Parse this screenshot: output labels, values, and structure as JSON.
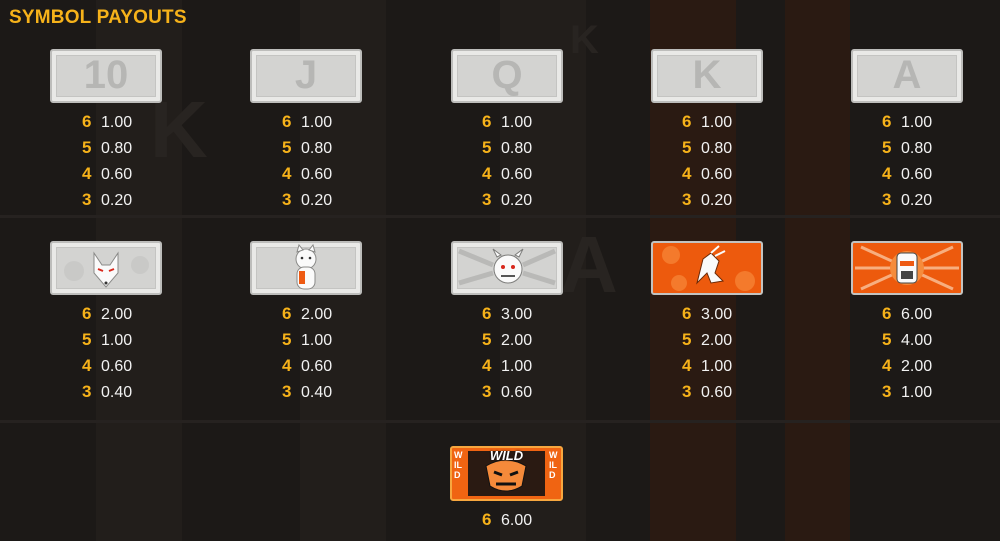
{
  "title": "SYMBOL PAYOUTS",
  "colors": {
    "accent": "#f6b21a",
    "value": "#f2f2f2",
    "background": "#1c1917",
    "orange": "#ed5a0d"
  },
  "symbols": [
    {
      "id": "ten",
      "label": "10",
      "icon": "ten-card-icon",
      "payouts": [
        {
          "count": "6",
          "value": "1.00"
        },
        {
          "count": "5",
          "value": "0.80"
        },
        {
          "count": "4",
          "value": "0.60"
        },
        {
          "count": "3",
          "value": "0.20"
        }
      ]
    },
    {
      "id": "jack",
      "label": "J",
      "icon": "jack-card-icon",
      "payouts": [
        {
          "count": "6",
          "value": "1.00"
        },
        {
          "count": "5",
          "value": "0.80"
        },
        {
          "count": "4",
          "value": "0.60"
        },
        {
          "count": "3",
          "value": "0.20"
        }
      ]
    },
    {
      "id": "queen",
      "label": "Q",
      "icon": "queen-card-icon",
      "payouts": [
        {
          "count": "6",
          "value": "1.00"
        },
        {
          "count": "5",
          "value": "0.80"
        },
        {
          "count": "4",
          "value": "0.60"
        },
        {
          "count": "3",
          "value": "0.20"
        }
      ]
    },
    {
      "id": "king",
      "label": "K",
      "icon": "king-card-icon",
      "payouts": [
        {
          "count": "6",
          "value": "1.00"
        },
        {
          "count": "5",
          "value": "0.80"
        },
        {
          "count": "4",
          "value": "0.60"
        },
        {
          "count": "3",
          "value": "0.20"
        }
      ]
    },
    {
      "id": "ace",
      "label": "A",
      "icon": "ace-card-icon",
      "payouts": [
        {
          "count": "6",
          "value": "1.00"
        },
        {
          "count": "5",
          "value": "0.80"
        },
        {
          "count": "4",
          "value": "0.60"
        },
        {
          "count": "3",
          "value": "0.20"
        }
      ]
    },
    {
      "id": "fox",
      "icon": "kitsune-mask-icon",
      "payouts": [
        {
          "count": "6",
          "value": "2.00"
        },
        {
          "count": "5",
          "value": "1.00"
        },
        {
          "count": "4",
          "value": "0.60"
        },
        {
          "count": "3",
          "value": "0.40"
        }
      ]
    },
    {
      "id": "cat",
      "icon": "lucky-cat-icon",
      "payouts": [
        {
          "count": "6",
          "value": "2.00"
        },
        {
          "count": "5",
          "value": "1.00"
        },
        {
          "count": "4",
          "value": "0.60"
        },
        {
          "count": "3",
          "value": "0.40"
        }
      ]
    },
    {
      "id": "oni",
      "icon": "oni-demon-icon",
      "payouts": [
        {
          "count": "6",
          "value": "3.00"
        },
        {
          "count": "5",
          "value": "2.00"
        },
        {
          "count": "4",
          "value": "1.00"
        },
        {
          "count": "3",
          "value": "0.60"
        }
      ]
    },
    {
      "id": "dragon",
      "icon": "dragon-icon",
      "payouts": [
        {
          "count": "6",
          "value": "3.00"
        },
        {
          "count": "5",
          "value": "2.00"
        },
        {
          "count": "4",
          "value": "1.00"
        },
        {
          "count": "3",
          "value": "0.60"
        }
      ]
    },
    {
      "id": "robot",
      "icon": "robot-samurai-icon",
      "payouts": [
        {
          "count": "6",
          "value": "6.00"
        },
        {
          "count": "5",
          "value": "4.00"
        },
        {
          "count": "4",
          "value": "2.00"
        },
        {
          "count": "3",
          "value": "1.00"
        }
      ]
    }
  ],
  "wild": {
    "label": "WILD",
    "side_label": "WILD",
    "icon": "wild-oni-mask-icon",
    "payouts": [
      {
        "count": "6",
        "value": "6.00"
      }
    ]
  }
}
